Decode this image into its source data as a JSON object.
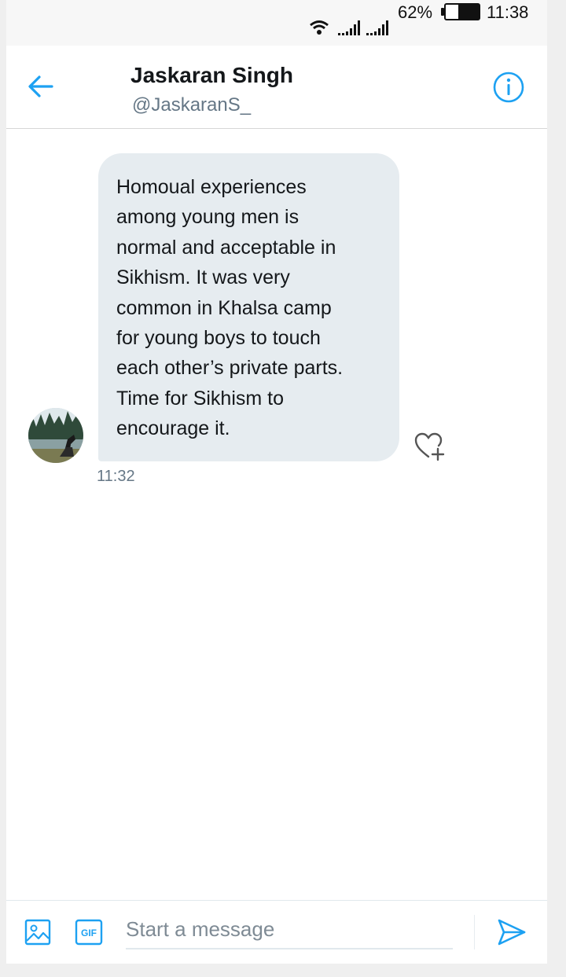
{
  "status_bar": {
    "battery_percent": "62%",
    "battery_level": 0.62,
    "time": "11:38",
    "icons": [
      "wifi-icon",
      "signal-icon",
      "signal-icon",
      "battery-icon"
    ]
  },
  "header": {
    "name": "Jaskaran Singh",
    "handle": "@JaskaranS_",
    "icons": [
      "back-arrow-icon",
      "info-icon"
    ]
  },
  "conversation": {
    "messages": [
      {
        "text": "Homoual experiences\namong young men is\nnormal and acceptable in\nSikhism. It was very\ncommon in Khalsa camp\nfor young boys to touch\neach other’s private parts.\nTime for Sikhism to\nencourage it.",
        "time": "11:32"
      }
    ]
  },
  "composer": {
    "placeholder": "Start a message",
    "value": "",
    "gif_label": "GIF",
    "icons": [
      "image-icon",
      "gif-icon",
      "send-icon"
    ]
  },
  "colors": {
    "accent": "#1da1f2",
    "bubble_bg": "#e6ecf0",
    "muted_text": "#657786"
  }
}
